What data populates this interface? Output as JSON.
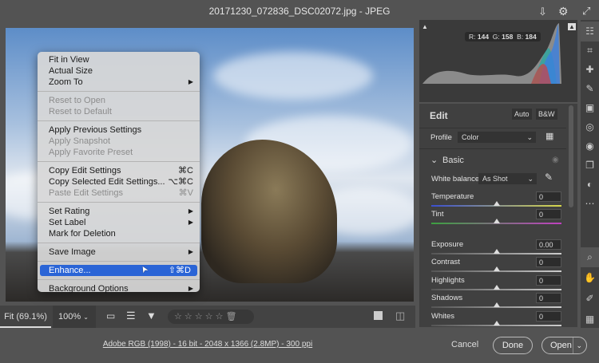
{
  "window": {
    "title": "20171230_072836_DSC02072.jpg  -  JPEG"
  },
  "histogram": {
    "r_label": "R:",
    "r": "144",
    "g_label": "G:",
    "g": "158",
    "b_label": "B:",
    "b": "184"
  },
  "context_menu": {
    "items": [
      {
        "label": "Fit in View",
        "enabled": true
      },
      {
        "label": "Actual Size",
        "enabled": true
      },
      {
        "label": "Zoom To",
        "enabled": true,
        "submenu": true
      },
      {
        "sep": true
      },
      {
        "label": "Reset to Open",
        "enabled": false
      },
      {
        "label": "Reset to Default",
        "enabled": false
      },
      {
        "sep": true
      },
      {
        "label": "Apply Previous Settings",
        "enabled": true
      },
      {
        "label": "Apply Snapshot",
        "enabled": false
      },
      {
        "label": "Apply Favorite Preset",
        "enabled": false
      },
      {
        "sep": true
      },
      {
        "label": "Copy Edit Settings",
        "enabled": true,
        "shortcut": "⌘C"
      },
      {
        "label": "Copy Selected Edit Settings...",
        "enabled": true,
        "shortcut": "⌥⌘C"
      },
      {
        "label": "Paste Edit Settings",
        "enabled": false,
        "shortcut": "⌘V"
      },
      {
        "sep": true
      },
      {
        "label": "Set Rating",
        "enabled": true,
        "submenu": true
      },
      {
        "label": "Set Label",
        "enabled": true,
        "submenu": true
      },
      {
        "label": "Mark for Deletion",
        "enabled": true
      },
      {
        "sep": true
      },
      {
        "label": "Save Image",
        "enabled": true,
        "submenu": true
      },
      {
        "sep": true
      },
      {
        "label": "Enhance...",
        "enabled": true,
        "shortcut": "⇧⌘D",
        "selected": true
      },
      {
        "sep": true
      },
      {
        "label": "Background Options",
        "enabled": true,
        "submenu": true
      }
    ]
  },
  "bottom_bar": {
    "fit": "Fit (69.1%)",
    "zoom": "100%",
    "stars": "☆ ☆ ☆ ☆ ☆"
  },
  "footer": {
    "info": "Adobe RGB (1998) - 16 bit - 2048 x 1366 (2.8MP) - 300 ppi",
    "cancel": "Cancel",
    "done": "Done",
    "open": "Open"
  },
  "edit": {
    "title": "Edit",
    "auto": "Auto",
    "bw": "B&W",
    "profile_label": "Profile",
    "profile_value": "Color",
    "basic": "Basic",
    "wb_label": "White balance",
    "wb_value": "As Shot",
    "sliders": [
      {
        "label": "Temperature",
        "value": "0",
        "position": 0.5,
        "gradient": "linear-gradient(90deg,#3a4fd0,#d8d84a)"
      },
      {
        "label": "Tint",
        "value": "0",
        "position": 0.5,
        "gradient": "linear-gradient(90deg,#3ca040,#c040c0)"
      },
      {
        "label": "Exposure",
        "value": "0.00",
        "position": 0.5,
        "gradient": "linear-gradient(90deg,#555,#ccc)"
      },
      {
        "label": "Contrast",
        "value": "0",
        "position": 0.5,
        "gradient": "linear-gradient(90deg,#555,#ccc)"
      },
      {
        "label": "Highlights",
        "value": "0",
        "position": 0.5,
        "gradient": "linear-gradient(90deg,#555,#ccc)"
      },
      {
        "label": "Shadows",
        "value": "0",
        "position": 0.5,
        "gradient": "linear-gradient(90deg,#555,#ccc)"
      },
      {
        "label": "Whites",
        "value": "0",
        "position": 0.5,
        "gradient": "linear-gradient(90deg,#555,#ccc)"
      }
    ]
  },
  "toolbar": {
    "icons": [
      "sliders-icon",
      "crop-icon",
      "healing-icon",
      "brush-icon",
      "gradient-icon",
      "radial-icon",
      "redeye-icon",
      "snapshots-icon",
      "presets-icon",
      "more-icon",
      "zoom-icon",
      "hand-icon",
      "sampler-icon",
      "grid-icon"
    ]
  }
}
